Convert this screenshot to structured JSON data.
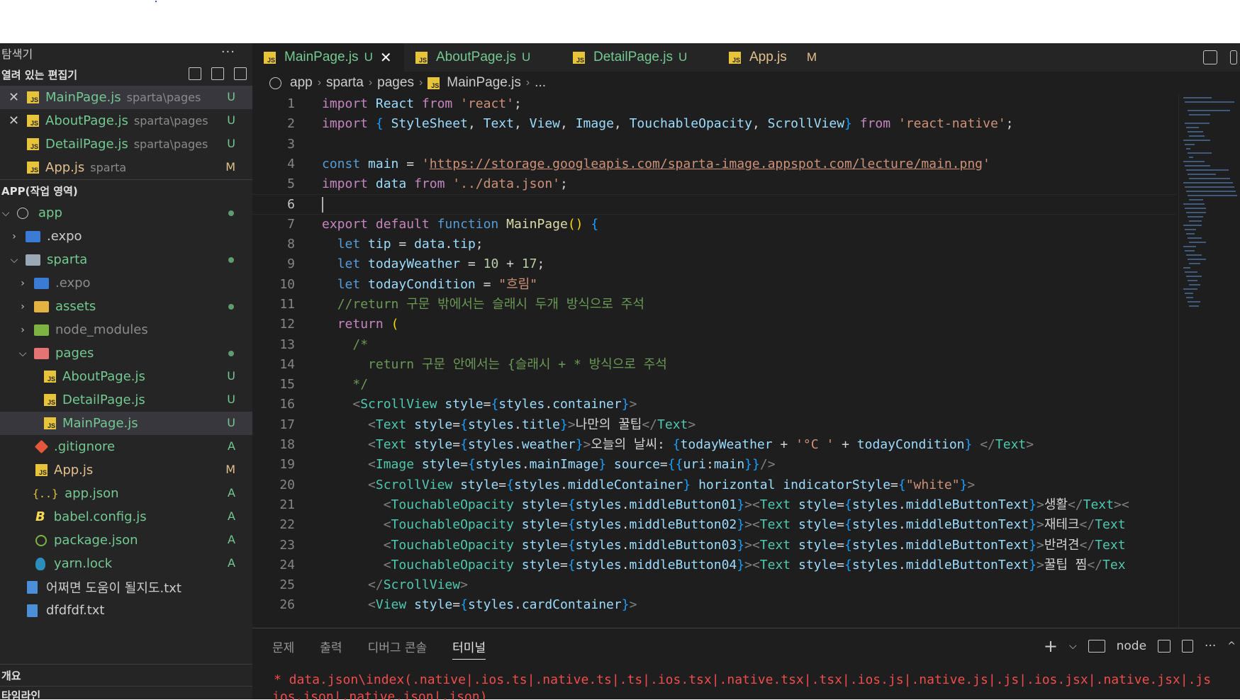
{
  "explorer": {
    "title": "탐색기",
    "more": "···",
    "open_editors": {
      "title": "열려 있는 편집기",
      "items": [
        {
          "name": "MainPage.js",
          "path": "sparta\\pages",
          "badge": "U",
          "close": "✕"
        },
        {
          "name": "AboutPage.js",
          "path": "sparta\\pages",
          "badge": "U",
          "close": "✕"
        },
        {
          "name": "DetailPage.js",
          "path": "sparta\\pages",
          "badge": "U"
        },
        {
          "name": "App.js",
          "path": "sparta",
          "badge": "M"
        }
      ]
    },
    "workspace": {
      "title": "APP(작업 영역)",
      "items": [
        {
          "name": "app"
        },
        {
          "name": ".expo"
        },
        {
          "name": "sparta"
        },
        {
          "name": ".expo"
        },
        {
          "name": "assets"
        },
        {
          "name": "node_modules"
        },
        {
          "name": "pages"
        },
        {
          "name": "AboutPage.js",
          "badge": "U"
        },
        {
          "name": "DetailPage.js",
          "badge": "U"
        },
        {
          "name": "MainPage.js",
          "badge": "U"
        },
        {
          "name": ".gitignore",
          "badge": "A"
        },
        {
          "name": "App.js",
          "badge": "M"
        },
        {
          "name": "app.json",
          "badge": "A"
        },
        {
          "name": "babel.config.js",
          "badge": "A"
        },
        {
          "name": "package.json",
          "badge": "A"
        },
        {
          "name": "yarn.lock",
          "badge": "A"
        },
        {
          "name": "어쩌면 도움이 될지도.txt"
        },
        {
          "name": "dfdfdf.txt"
        }
      ]
    },
    "outline": "개요",
    "timeline": "타임라인"
  },
  "tabs": [
    {
      "name": "MainPage.js",
      "badge": "U",
      "close": "✕"
    },
    {
      "name": "AboutPage.js",
      "badge": "U"
    },
    {
      "name": "DetailPage.js",
      "badge": "U"
    },
    {
      "name": "App.js",
      "badge": "M"
    }
  ],
  "breadcrumb": {
    "app": "app",
    "sparta": "sparta",
    "pages": "pages",
    "file": "MainPage.js",
    "more": "..."
  },
  "code_lines": [
    "import React from 'react';",
    "import { StyleSheet, Text, View, Image, TouchableOpacity, ScrollView} from 'react-native';",
    "",
    "const main = 'https://storage.googleapis.com/sparta-image.appspot.com/lecture/main.png'",
    "import data from '../data.json';",
    "",
    "export default function MainPage() {",
    "  let tip = data.tip;",
    "  let todayWeather = 10 + 17;",
    "  let todayCondition = \"흐림\"",
    "  //return 구문 밖에서는 슬래시 두개 방식으로 주석",
    "  return (",
    "    /*",
    "      return 구문 안에서는 {슬래시 + * 방식으로 주석",
    "    */",
    "    <ScrollView style={styles.container}>",
    "      <Text style={styles.title}>나만의 꿀팁</Text>",
    "      <Text style={styles.weather}>오늘의 날씨: {todayWeather + '°C ' + todayCondition} </Text>",
    "      <Image style={styles.mainImage} source={{uri:main}}/>",
    "      <ScrollView style={styles.middleContainer} horizontal indicatorStyle={\"white\"}>",
    "        <TouchableOpacity style={styles.middleButton01}><Text style={styles.middleButtonText}>생활</Text><",
    "        <TouchableOpacity style={styles.middleButton02}><Text style={styles.middleButtonText}>재테크</Text",
    "        <TouchableOpacity style={styles.middleButton03}><Text style={styles.middleButtonText}>반려견</Text",
    "        <TouchableOpacity style={styles.middleButton04}><Text style={styles.middleButtonText}>꿀팁 찜</Tex",
    "      </ScrollView>",
    "      <View style={styles.cardContainer}>"
  ],
  "panel": {
    "tabs": [
      "문제",
      "출력",
      "디버그 콘솔",
      "터미널"
    ],
    "active": "터미널",
    "shell": "node",
    "terminal_line1": "* data.json\\index(.native|.ios.ts|.native.ts|.ts|.ios.tsx|.native.tsx|.tsx|.ios.js|.native.js|.js|.ios.jsx|.native.jsx|.js",
    "terminal_line2": "ios.json|.native.json|.json)"
  },
  "colors": {
    "sidebar_bg": "#252526",
    "editor_bg": "#1e1e1e",
    "js_icon": "#e8c43a",
    "untracked": "#73c991",
    "modified": "#e2c08d",
    "error": "#f14c4c"
  }
}
